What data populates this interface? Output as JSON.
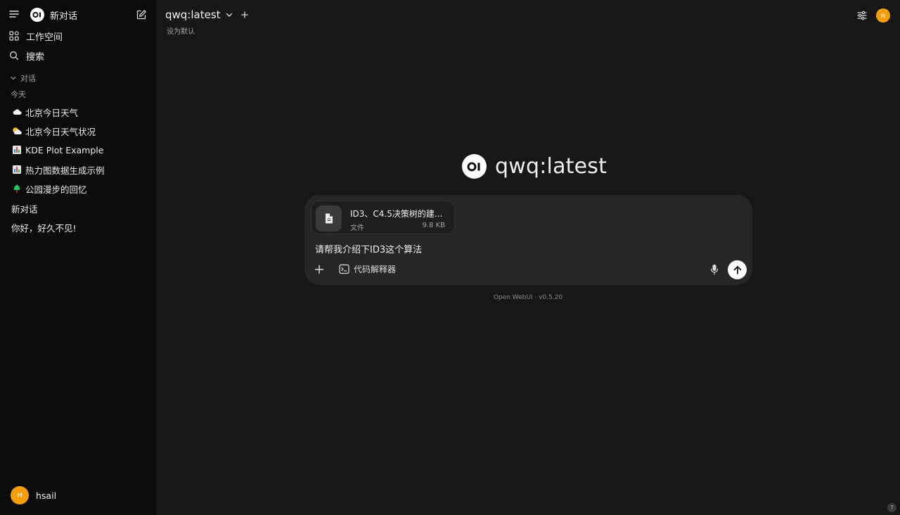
{
  "sidebar": {
    "new_chat": "新对话",
    "workspace": "工作空间",
    "search": "搜索",
    "section_label": "对话",
    "today_label": "今天",
    "chats": [
      {
        "emoji": "☁️",
        "title": "北京今日天气"
      },
      {
        "emoji": "🌥️",
        "title": "北京今日天气状况"
      },
      {
        "emoji": "📊",
        "title": "KDE Plot Example"
      },
      {
        "emoji": "📊",
        "title": "热力图数据生成示例"
      },
      {
        "emoji": "🌳",
        "title": "公园漫步的回忆"
      },
      {
        "emoji": "",
        "title": "新对话"
      },
      {
        "emoji": "",
        "title": "你好，好久不见!"
      }
    ],
    "user": {
      "initial": "H",
      "name": "hsail"
    }
  },
  "header": {
    "model": "qwq:latest",
    "set_default": "设为默认",
    "avatar_initial": "H"
  },
  "hero": {
    "title": "qwq:latest"
  },
  "composer": {
    "file": {
      "name": "ID3、C4.5决策树的建...",
      "type": "文件",
      "size": "9.8 KB"
    },
    "prompt": "请帮我介绍下ID3这个算法",
    "tool_label": "代码解释器"
  },
  "footer": {
    "version": "Open WebUI · v0.5.20"
  },
  "help": "?",
  "colors": {
    "accent_avatar": "#f59e0b",
    "sidebar_bg": "#0b0b0b",
    "main_bg": "#171717",
    "composer_bg": "#262626"
  }
}
